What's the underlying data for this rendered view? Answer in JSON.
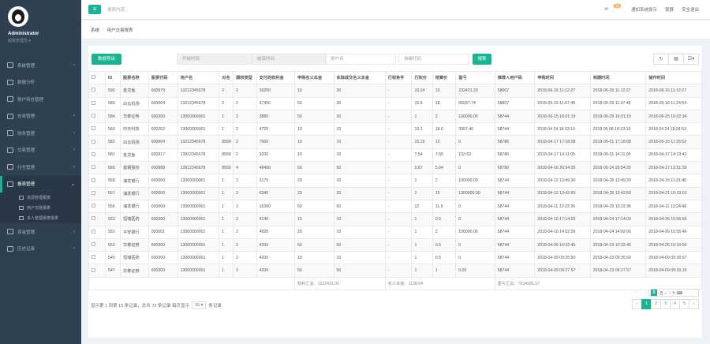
{
  "sidebar": {
    "name": "Administrator",
    "role": "超级管理员 ▾",
    "items": [
      {
        "label": "系统管理",
        "arrow": "‹"
      },
      {
        "label": "数据分析",
        "arrow": ""
      },
      {
        "label": "账户持仓管理",
        "arrow": ""
      },
      {
        "label": "仓单管理",
        "arrow": "‹"
      },
      {
        "label": "财务管理",
        "arrow": "‹"
      },
      {
        "label": "交易管理",
        "arrow": "‹"
      },
      {
        "label": "行仓管理",
        "arrow": "‹"
      },
      {
        "label": "报表管理",
        "arrow": "⌄"
      }
    ],
    "sub": [
      {
        "label": "资源管理报表"
      },
      {
        "label": "用户交易报表"
      },
      {
        "label": "本人管理报表报表"
      }
    ],
    "items2": [
      {
        "label": "资金管理",
        "arrow": "‹"
      },
      {
        "label": "历史记录",
        "arrow": "‹"
      }
    ]
  },
  "topbar": {
    "search": "搜索内容...",
    "badge": "48",
    "msg": "通知系统提示",
    "logout1": "锁屏",
    "logout2": "安全退出"
  },
  "crumb": {
    "home": "系统",
    "current": "用户交易报表"
  },
  "toolbar": {
    "export": "数据导出",
    "start": "开始时间",
    "end": "结束时间",
    "user": "用户名",
    "code": "自编代码",
    "search": "搜索"
  },
  "columns": [
    "ID",
    "股票名称",
    "股票代码",
    "用户名",
    "对名",
    "期权类型",
    "支付的权利金",
    "申购名义本金",
    "实际成交名义本金",
    "行权条件",
    "行权价",
    "结算价",
    "盈亏",
    "推荐人用户码",
    "申购时间",
    "到期时间",
    "操作时间"
  ],
  "rows": [
    [
      "590",
      "金龙鱼",
      "600979",
      "13212345678",
      "2",
      "2",
      "39250",
      "10",
      "30",
      "-",
      "10.24",
      "15",
      "232421.33",
      "58007",
      "2018-06-16 11:12:27",
      "2018-06-29 11:12:27",
      "2018-06-16 11:12:27"
    ],
    [
      "589",
      "白云机场",
      "600004",
      "13212345678",
      "2",
      "2",
      "37450",
      "50",
      "30",
      "-",
      "15.9",
      "18",
      "66037.74",
      "58807",
      "2018-05-15 11:07:48",
      "2018-05-29 11:07:48",
      "2018-06-18 11:24:54"
    ],
    [
      "584",
      "华泰证券",
      "600300",
      "13000000001",
      "1",
      "2",
      "3880",
      "50",
      "30",
      "-",
      "1",
      "2",
      "100000.00",
      "58744",
      "2018-06-15 16:01:19",
      "2018-06-29 16:01:19",
      "2018-06-25 16:02:34"
    ],
    [
      "583",
      "中天科技",
      "600262",
      "13000000001",
      "1",
      "2",
      "4720",
      "10",
      "10",
      "-",
      "10.1",
      "18.0",
      "3067.40",
      "58744",
      "2018 04 24 18:23:10",
      "2018 05 08 18:23:10",
      "2018 04 24 18:24:53"
    ],
    [
      "582",
      "白云机场",
      "600004",
      "13212345678",
      "8558",
      "2",
      "7660",
      "10",
      "10",
      "-",
      "15.19",
      "12",
      "0",
      "58786",
      "2018-04-17 17:18:08",
      "2018-05-01 17:18:08",
      "2018-05-15 11:26:52"
    ],
    [
      "581",
      "金龙鱼",
      "600917",
      "13912345678",
      "8558",
      "2",
      "9200",
      "10",
      "10",
      "-",
      "7.54",
      "7.55",
      "132.63",
      "58786",
      "2018-04-17 14:11:05",
      "2018-05-01 14:11:05",
      "2018-04-17 14:13:41"
    ],
    [
      "580",
      "首钢股份",
      "600888",
      "13912345678",
      "8558",
      "4",
      "48450",
      "50",
      "50",
      "-",
      "5.67",
      "5.64",
      "0",
      "58786",
      "2018-04-16 20:54:25",
      "2018-05-14 20:54:25",
      "2018-04-17 13:51:39"
    ],
    [
      "568",
      "浦发银行",
      "600000",
      "13000000001",
      "1",
      "2",
      "3170",
      "20",
      "20",
      "-",
      "1",
      "2",
      "100000.00",
      "58744",
      "2018-04-12 13:49:30",
      "2018-04-26 13:49:30",
      "2018-04-16 11:21:40"
    ],
    [
      "567",
      "浦发银行",
      "600000",
      "13000000001",
      "1",
      "2",
      "6340",
      "20",
      "20",
      "-",
      "2",
      "15",
      "1300000.00",
      "58744",
      "2018-04-12 13:42:60",
      "2018-04-26 13:42:60",
      "2018-04-21 16:33:01"
    ],
    [
      "556",
      "浦发银行",
      "600000",
      "13000000001",
      "1",
      "2",
      "16300",
      "50",
      "50",
      "-",
      "12",
      "11.5",
      "0",
      "58744",
      "2018-04-11 13:22:36",
      "2018-04-25 13:22:36",
      "2018-04-11 13:24:48"
    ],
    [
      "553",
      "恒瑞医药",
      "600300",
      "13000000001",
      "1",
      "2",
      "4140",
      "10",
      "10",
      "-",
      "1",
      "0.5",
      "0",
      "58744",
      "2018-04-10 17:14:03",
      "2018-04-24 17:14:03",
      "2018-04-26 15:56:56"
    ],
    [
      "552",
      "平安银行",
      "000001",
      "13000000001",
      "1",
      "2",
      "4820",
      "20",
      "10",
      "-",
      "1",
      "2",
      "100000.00",
      "58744",
      "2018-04-10 14:02:06",
      "2018-04-24 14:02:06",
      "2018-04-26 15:55:46"
    ],
    [
      "550",
      "华泰证券",
      "600300",
      "13000000001",
      "1",
      "2",
      "4200",
      "50",
      "50",
      "-",
      "1",
      "0.5",
      "0",
      "58744",
      "2018-04-09 10:32:45",
      "2018-04-23 10:32:45",
      "2018-04-26 10:33:50"
    ],
    [
      "549",
      "恒瑞医药",
      "600300",
      "13000000001",
      "1",
      "2",
      "4200",
      "10",
      "10",
      "-",
      "1",
      "0.5",
      "0",
      "58744",
      "2018-04-09 09:35:50",
      "2018-04-23 09:35:50",
      "2018-04-09 09:36:57"
    ],
    [
      "547",
      "华泰证券",
      "600300",
      "13000000001",
      "1",
      "2",
      "4200",
      "50",
      "50",
      "-",
      "1",
      "1",
      "0.00",
      "58744",
      "2018-04-09 09:27.57",
      "2018-04-23 09:27.57",
      "2018-04-09 09:33.10"
    ]
  ],
  "sums": {
    "premium": "权利汇总：1122431.00",
    "notional": "名义本金：1138.64",
    "pnl": "盈亏汇总：7634081.57"
  },
  "pagination": {
    "info": "显示第 1 到第 15 条记录，总共 73 条记录 每页显示",
    "size": "15 ▾",
    "suffix": "条记录",
    "pages": [
      "‹",
      "1",
      "2",
      "3",
      "4",
      "5",
      "›"
    ]
  },
  "ime": {
    "s": "S",
    "text": "五 ♪ ☽ ✎ ⌨"
  },
  "colors": {
    "sidebar": "#2f4050",
    "accent": "#1ab394"
  }
}
